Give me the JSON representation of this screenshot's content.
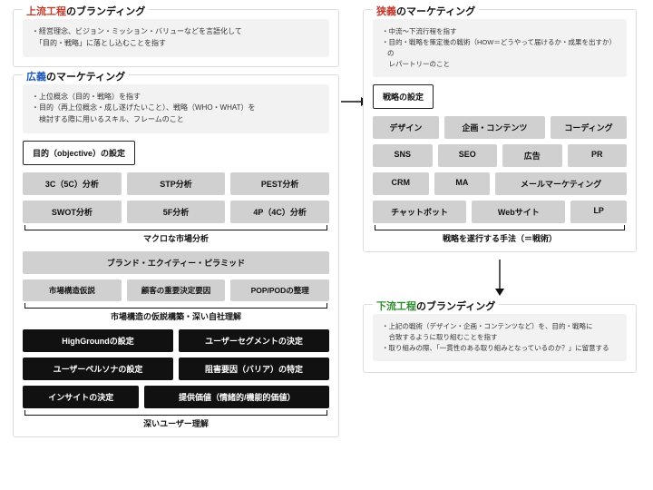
{
  "left": {
    "branding_upstream": {
      "title_prefix": "上流工程",
      "title_suffix": "のブランディング",
      "desc": [
        "・経営理念、ビジョン・ミッション・バリューなどを言語化して",
        "　「目的・戦略」に落とし込むことを指す"
      ]
    },
    "broad_marketing": {
      "title_prefix": "広義",
      "title_suffix": "のマーケティング",
      "desc": [
        "・上位概念（目的・戦略）を指す",
        "・目的（再上位概念・成し遂げたいこと）、戦略（WHO・WHAT）を",
        "　検討する際に用いるスキル、フレームのこと"
      ],
      "objective_label": "目的（objective）の設定",
      "macro_row1": [
        "3C（5C）分析",
        "STP分析",
        "PEST分析"
      ],
      "macro_row2": [
        "SWOT分析",
        "5F分析",
        "4P（4C）分析"
      ],
      "macro_label": "マクロな市場分析",
      "struct_row1": [
        "ブランド・エクイティー・ピラミッド"
      ],
      "struct_row2": [
        "市場構造仮説",
        "顧客の重要決定要因",
        "POP/PODの整理"
      ],
      "struct_label": "市場構造の仮説構築・深い自社理解",
      "user_row1": [
        "HighGroundの設定",
        "ユーザーセグメントの決定"
      ],
      "user_row2": [
        "ユーザーペルソナの設定",
        "阻害要因（バリア）の特定"
      ],
      "user_row3": [
        "インサイトの決定",
        "提供価値（情緒的/機能的価値）"
      ],
      "user_label": "深いユーザー理解"
    }
  },
  "right": {
    "narrow_marketing": {
      "title_prefix": "狭義",
      "title_suffix": "のマーケティング",
      "desc": [
        "・中流～下流行程を指す",
        "・目的・戦略を策定後の戦術（HOW＝どうやって届けるか・成果を出すか）の",
        "　レパートリーのこと"
      ],
      "strategy_label": "戦略の設定",
      "tactics_row1": [
        "デザイン",
        "企画・コンテンツ",
        "コーディング"
      ],
      "tactics_row2": [
        "SNS",
        "SEO",
        "広告",
        "PR"
      ],
      "tactics_row3": [
        "CRM",
        "MA",
        "メールマーケティング"
      ],
      "tactics_row4": [
        "チャットボット",
        "Webサイト",
        "LP"
      ],
      "tactics_label": "戦略を遂行する手法（＝戦術）"
    },
    "branding_downstream": {
      "title_prefix": "下流工程",
      "title_suffix": "のブランディング",
      "desc": [
        "・上記の戦術（デザイン・企画・コンテンツなど）を、目的・戦略に",
        "　合致するように取り組むことを指す",
        "・取り組みの際、「一貫性のある取り組みとなっているのか？」に留意する"
      ]
    }
  }
}
